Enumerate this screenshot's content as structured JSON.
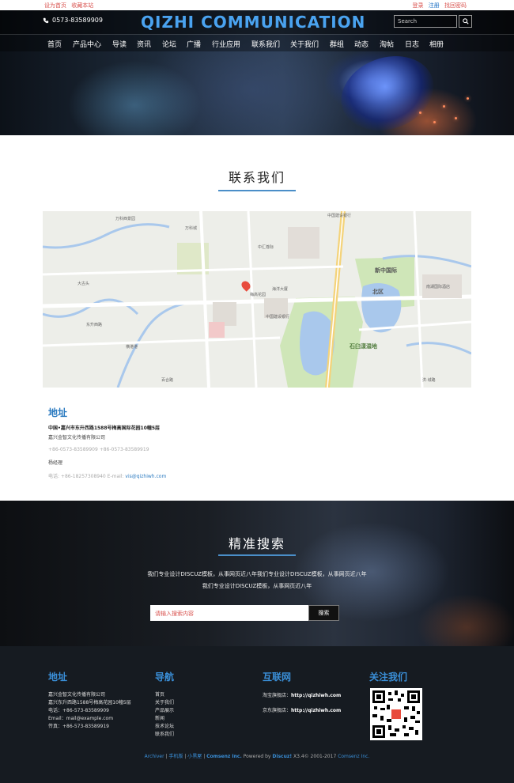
{
  "topbar": {
    "set_home": "设为首页",
    "bookmark": "收藏本站",
    "login": "登录",
    "register": "注册",
    "forgot": "找回密码"
  },
  "header": {
    "phone": "0573-83589909",
    "logo": "QIZHI COMMUNICATION",
    "search_placeholder": "Search",
    "search_icon": "search-icon"
  },
  "nav": [
    "首页",
    "产品中心",
    "导读",
    "资讯",
    "论坛",
    "广播",
    "行业应用",
    "联系我们",
    "关于我们",
    "群组",
    "动态",
    "淘帖",
    "日志",
    "相册"
  ],
  "contact": {
    "title": "联系我们",
    "map": {
      "district_1": "北区",
      "district_2": "新中国际",
      "park": "石臼漾湿地"
    },
    "address_heading": "地址",
    "address_line": "中国•嘉兴市东升西路1588号梅高国际花园10幢5层",
    "company": "嘉兴金智文化传播有限公司",
    "phone_fax": "+86-0573-83589909 +86-0573-83589919",
    "contact_person": "杨经理",
    "mobile_email_prefix": "电话: +86-18257308940  E-mail:",
    "email": "vis@qizhiwh.com"
  },
  "search_band": {
    "title": "精准搜索",
    "desc_line1": "我们专业设计DISCUZ模板，从事网页近八年我们专业设计DISCUZ模板，从事网页近八年",
    "desc_line2": "我们专业设计DISCUZ模板，从事网页近八年",
    "input_placeholder": "请输入搜索内容",
    "button": "搜索"
  },
  "footer": {
    "col1": {
      "title": "地址",
      "lines": [
        "嘉兴金智文化传播有限公司",
        "嘉兴东升西路1588号梅高花园10幢5层",
        "电话：+86-573-83589909",
        "Email：mail@example.com",
        "传真：+86-573-83589919"
      ]
    },
    "col2": {
      "title": "导航",
      "lines": [
        "首页",
        "关于我们",
        "产品展示",
        "新闻",
        "技术论坛",
        "联系我们"
      ]
    },
    "col3": {
      "title": "互联网",
      "taobao_label": "淘宝旗舰店：",
      "taobao_url": "http://qizhiwh.com",
      "jd_label": "京东旗舰店：",
      "jd_url": "http://qizhiwh.com"
    },
    "col4": {
      "title": "关注我们"
    },
    "copyright": {
      "archiver": "Archiver",
      "mobile": "手机版",
      "blackroom": "小黑屋",
      "comsenz": "Comsenz Inc.",
      "powered": "Powered by",
      "discuz": "Discuz!",
      "version": "X3.4© 2001-2017",
      "comsenz2": "Comsenz Inc."
    }
  }
}
